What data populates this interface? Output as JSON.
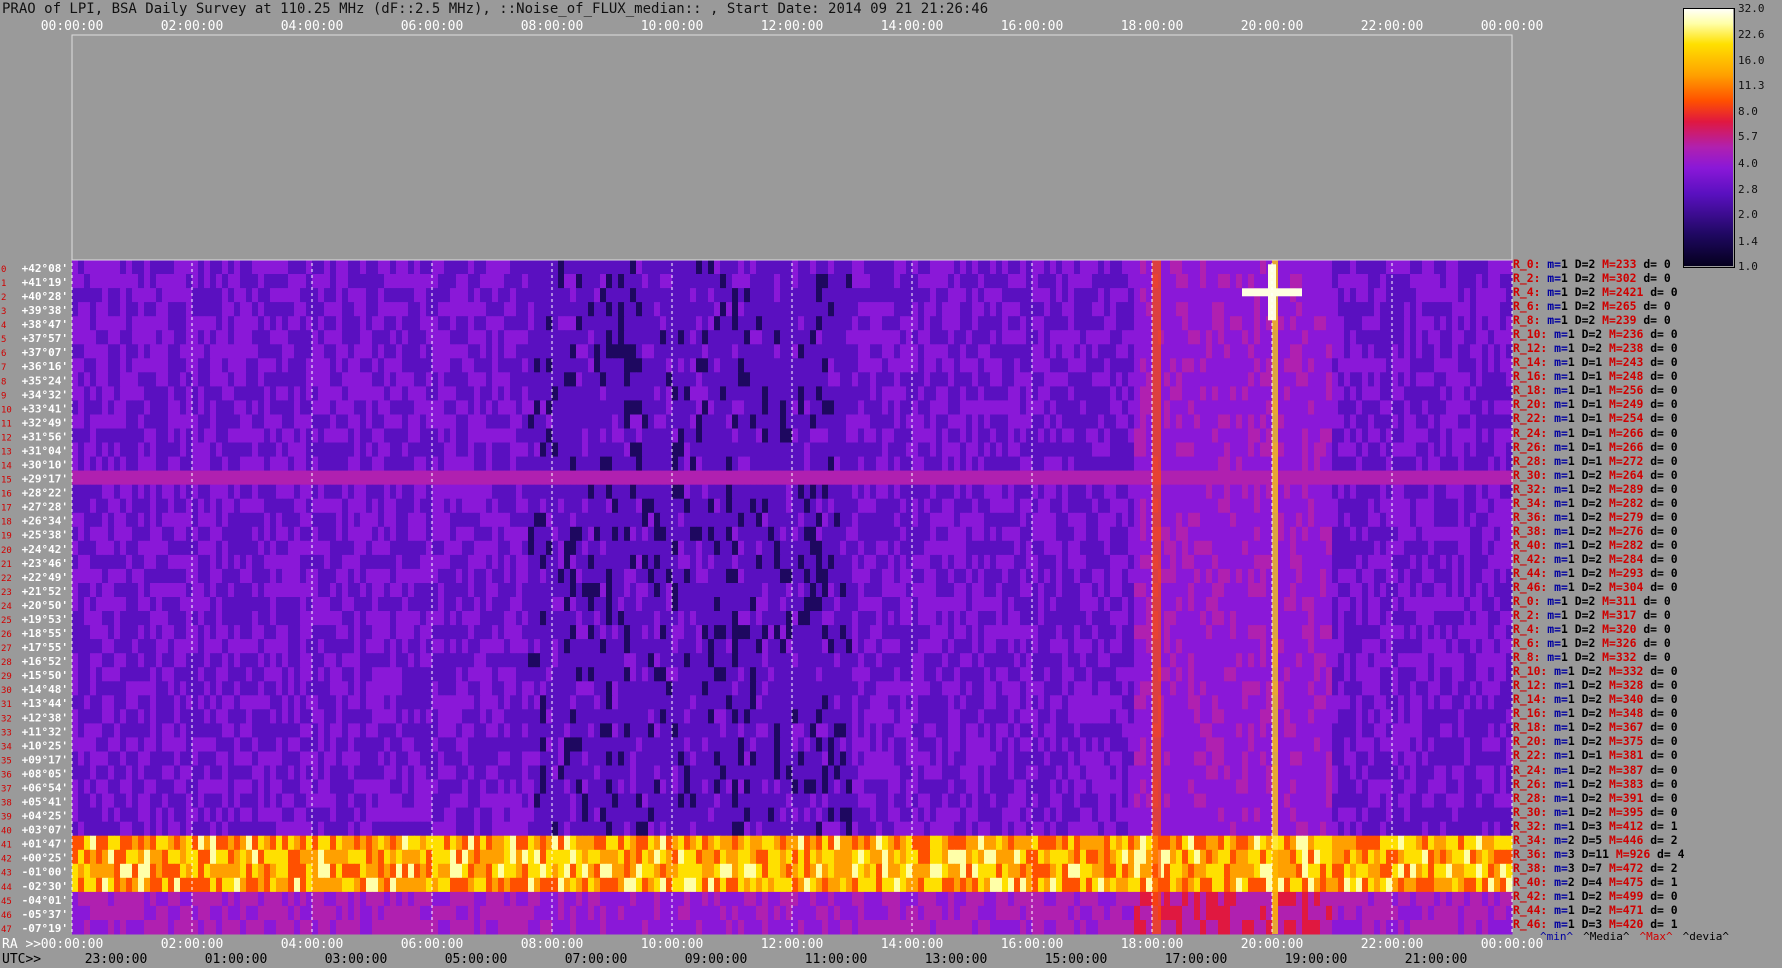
{
  "title": "PRAO of LPI, BSA Daily Survey at 110.25 MHz (dF::2.5 MHz), ::Noise_of_FLUX_median:: , Start Date: 2014 09 21 21:26:46",
  "chart_data": {
    "type": "heatmap",
    "title": "PRAO of LPI, BSA Daily Survey at 110.25 MHz (dF::2.5 MHz), ::Noise_of_FLUX_median:: , Start Date: 2014 09 21 21:26:46",
    "x_top_ticks": [
      "00:00:00",
      "02:00:00",
      "04:00:00",
      "06:00:00",
      "08:00:00",
      "10:00:00",
      "12:00:00",
      "14:00:00",
      "16:00:00",
      "18:00:00",
      "20:00:00",
      "22:00:00",
      "00:00:00"
    ],
    "x_ra_prefix": "RA >>",
    "x_ra_ticks": [
      "00:00:00",
      "02:00:00",
      "04:00:00",
      "06:00:00",
      "08:00:00",
      "10:00:00",
      "12:00:00",
      "14:00:00",
      "16:00:00",
      "18:00:00",
      "20:00:00",
      "22:00:00",
      "00:00:00"
    ],
    "x_utc_prefix": "UTC>>",
    "x_utc_ticks": [
      "23:00:00",
      "01:00:00",
      "03:00:00",
      "05:00:00",
      "07:00:00",
      "09:00:00",
      "11:00:00",
      "13:00:00",
      "15:00:00",
      "17:00:00",
      "19:00:00",
      "21:00:00"
    ],
    "y_ticks": [
      "+42°08'",
      "+41°19'",
      "+40°28'",
      "+39°38'",
      "+38°47'",
      "+37°57'",
      "+37°07'",
      "+36°16'",
      "+35°24'",
      "+34°32'",
      "+33°41'",
      "+32°49'",
      "+31°56'",
      "+31°04'",
      "+30°10'",
      "+29°17'",
      "+28°22'",
      "+27°28'",
      "+26°34'",
      "+25°38'",
      "+24°42'",
      "+23°46'",
      "+22°49'",
      "+21°52'",
      "+20°50'",
      "+19°53'",
      "+18°55'",
      "+17°55'",
      "+16°52'",
      "+15°50'",
      "+14°48'",
      "+13°44'",
      "+12°38'",
      "+11°32'",
      "+10°25'",
      "+09°17'",
      "+08°05'",
      "+06°54'",
      "+05°41'",
      "+04°25'",
      "+03°07'",
      "+01°47'",
      "+00°25'",
      "-01°00'",
      "-02°30'",
      "-04°01'",
      "-05°37'",
      "-07°19'"
    ],
    "ray_index_labels": [
      "0",
      "1",
      "2",
      "3",
      "4",
      "5",
      "6",
      "7",
      "8",
      "9",
      "10",
      "11",
      "12",
      "13",
      "14",
      "15",
      "16",
      "17",
      "18",
      "19",
      "20",
      "21",
      "22",
      "23",
      "24",
      "25",
      "26",
      "27",
      "28",
      "29",
      "30",
      "31",
      "32",
      "33",
      "34",
      "35",
      "36",
      "37",
      "38",
      "39",
      "40",
      "41",
      "42",
      "43",
      "44",
      "45",
      "46",
      "47"
    ],
    "colorbar_ticks": [
      "32.0",
      "22.6",
      "16.0",
      "11.3",
      "8.0",
      "5.7",
      "4.0",
      "2.8",
      "2.0",
      "1.4",
      "1.0"
    ],
    "colorbar_scale": "log",
    "colorbar_range": [
      1.0,
      32.0
    ],
    "colormap": [
      "#05001e",
      "#1e0860",
      "#5a10c0",
      "#8a18d8",
      "#b020b0",
      "#e01840",
      "#ff5000",
      "#ffa000",
      "#ffe000",
      "#ffffa8",
      "#ffffff"
    ],
    "features": [
      {
        "desc": "strong source",
        "ra": "20:00",
        "dec": "+40°28'"
      },
      {
        "desc": "strong band",
        "dec": "+00°25'"
      },
      {
        "desc": "vertical band",
        "ra": "18:00"
      }
    ]
  },
  "rays_status": [
    {
      "r": "R_0:",
      "m": "1",
      "d": "2",
      "M": "233",
      "dv": "0"
    },
    {
      "r": "R_2:",
      "m": "1",
      "d": "2",
      "M": "302",
      "dv": "0"
    },
    {
      "r": "R_4:",
      "m": "1",
      "d": "2",
      "M": "2421",
      "dv": "0"
    },
    {
      "r": "R_6:",
      "m": "1",
      "d": "2",
      "M": "265",
      "dv": "0"
    },
    {
      "r": "R_8:",
      "m": "1",
      "d": "2",
      "M": "239",
      "dv": "0"
    },
    {
      "r": "R_10:",
      "m": "1",
      "d": "2",
      "M": "236",
      "dv": "0"
    },
    {
      "r": "R_12:",
      "m": "1",
      "d": "2",
      "M": "238",
      "dv": "0"
    },
    {
      "r": "R_14:",
      "m": "1",
      "d": "1",
      "M": "243",
      "dv": "0"
    },
    {
      "r": "R_16:",
      "m": "1",
      "d": "1",
      "M": "248",
      "dv": "0"
    },
    {
      "r": "R_18:",
      "m": "1",
      "d": "1",
      "M": "256",
      "dv": "0"
    },
    {
      "r": "R_20:",
      "m": "1",
      "d": "1",
      "M": "249",
      "dv": "0"
    },
    {
      "r": "R_22:",
      "m": "1",
      "d": "1",
      "M": "254",
      "dv": "0"
    },
    {
      "r": "R_24:",
      "m": "1",
      "d": "1",
      "M": "266",
      "dv": "0"
    },
    {
      "r": "R_26:",
      "m": "1",
      "d": "1",
      "M": "266",
      "dv": "0"
    },
    {
      "r": "R_28:",
      "m": "1",
      "d": "1",
      "M": "272",
      "dv": "0"
    },
    {
      "r": "R_30:",
      "m": "1",
      "d": "2",
      "M": "264",
      "dv": "0"
    },
    {
      "r": "R_32:",
      "m": "1",
      "d": "2",
      "M": "289",
      "dv": "0"
    },
    {
      "r": "R_34:",
      "m": "1",
      "d": "2",
      "M": "282",
      "dv": "0"
    },
    {
      "r": "R_36:",
      "m": "1",
      "d": "2",
      "M": "279",
      "dv": "0"
    },
    {
      "r": "R_38:",
      "m": "1",
      "d": "2",
      "M": "276",
      "dv": "0"
    },
    {
      "r": "R_40:",
      "m": "1",
      "d": "2",
      "M": "282",
      "dv": "0"
    },
    {
      "r": "R_42:",
      "m": "1",
      "d": "2",
      "M": "284",
      "dv": "0"
    },
    {
      "r": "R_44:",
      "m": "1",
      "d": "2",
      "M": "293",
      "dv": "0"
    },
    {
      "r": "R_46:",
      "m": "1",
      "d": "2",
      "M": "304",
      "dv": "0"
    },
    {
      "r": "R_0:",
      "m": "1",
      "d": "2",
      "M": "311",
      "dv": "0"
    },
    {
      "r": "R_2:",
      "m": "1",
      "d": "2",
      "M": "317",
      "dv": "0"
    },
    {
      "r": "R_4:",
      "m": "1",
      "d": "2",
      "M": "320",
      "dv": "0"
    },
    {
      "r": "R_6:",
      "m": "1",
      "d": "2",
      "M": "326",
      "dv": "0"
    },
    {
      "r": "R_8:",
      "m": "1",
      "d": "2",
      "M": "332",
      "dv": "0"
    },
    {
      "r": "R_10:",
      "m": "1",
      "d": "2",
      "M": "332",
      "dv": "0"
    },
    {
      "r": "R_12:",
      "m": "1",
      "d": "2",
      "M": "328",
      "dv": "0"
    },
    {
      "r": "R_14:",
      "m": "1",
      "d": "2",
      "M": "340",
      "dv": "0"
    },
    {
      "r": "R_16:",
      "m": "1",
      "d": "2",
      "M": "348",
      "dv": "0"
    },
    {
      "r": "R_18:",
      "m": "1",
      "d": "2",
      "M": "367",
      "dv": "0"
    },
    {
      "r": "R_20:",
      "m": "1",
      "d": "2",
      "M": "375",
      "dv": "0"
    },
    {
      "r": "R_22:",
      "m": "1",
      "d": "1",
      "M": "381",
      "dv": "0"
    },
    {
      "r": "R_24:",
      "m": "1",
      "d": "2",
      "M": "387",
      "dv": "0"
    },
    {
      "r": "R_26:",
      "m": "1",
      "d": "2",
      "M": "383",
      "dv": "0"
    },
    {
      "r": "R_28:",
      "m": "1",
      "d": "2",
      "M": "391",
      "dv": "0"
    },
    {
      "r": "R_30:",
      "m": "1",
      "d": "2",
      "M": "395",
      "dv": "0"
    },
    {
      "r": "R_32:",
      "m": "1",
      "d": "3",
      "M": "412",
      "dv": "1"
    },
    {
      "r": "R_34:",
      "m": "2",
      "d": "5",
      "M": "446",
      "dv": "2"
    },
    {
      "r": "R_36:",
      "m": "3",
      "d": "11",
      "M": "926",
      "dv": "4"
    },
    {
      "r": "R_38:",
      "m": "3",
      "d": "7",
      "M": "472",
      "dv": "2"
    },
    {
      "r": "R_40:",
      "m": "2",
      "d": "4",
      "M": "475",
      "dv": "1"
    },
    {
      "r": "R_42:",
      "m": "1",
      "d": "2",
      "M": "499",
      "dv": "0"
    },
    {
      "r": "R_44:",
      "m": "1",
      "d": "2",
      "M": "471",
      "dv": "0"
    },
    {
      "r": "R_46:",
      "m": "1",
      "d": "3",
      "M": "420",
      "dv": "1"
    }
  ],
  "status_keys": {
    "m": "m=",
    "d": "D=",
    "M": "M=",
    "dv": "d= "
  },
  "legend_keys": [
    "^min^",
    "^Media^",
    "^Max^",
    "^devia^"
  ]
}
